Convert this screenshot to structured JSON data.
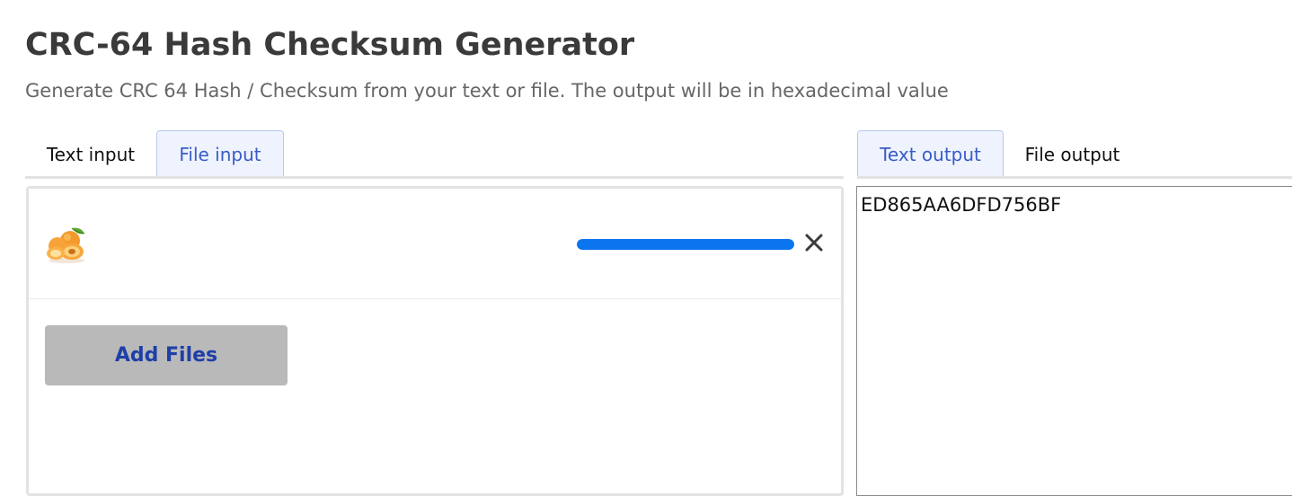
{
  "header": {
    "title": "CRC-64 Hash Checksum Generator",
    "subtitle": "Generate CRC 64 Hash / Checksum from your text or file. The output will be in hexadecimal value"
  },
  "input": {
    "tabs": [
      {
        "label": "Text input",
        "active": false
      },
      {
        "label": "File input",
        "active": true
      }
    ],
    "file": {
      "thumbnail_icon": "apricot-image",
      "upload_progress": 1.0,
      "progress_color": "#0b75f0",
      "remove_icon": "close-icon"
    },
    "add_files_label": "Add Files"
  },
  "output": {
    "tabs": [
      {
        "label": "Text output",
        "active": true
      },
      {
        "label": "File output",
        "active": false
      }
    ],
    "value": "ED865AA6DFD756BF"
  },
  "colors": {
    "active_tab_bg": "#eef3fd",
    "active_tab_text": "#3a5bc7",
    "button_bg": "#b9b9b9",
    "button_text": "#1e3fa8"
  }
}
